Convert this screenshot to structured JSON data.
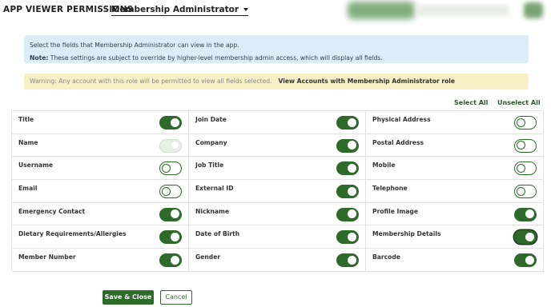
{
  "header": {
    "title": "APP VIEWER PERMISSIONS",
    "role_selected": "Membership Administrator"
  },
  "info": {
    "line1": "Select the fields that Membership Administrator can view in the app.",
    "note_label": "Note:",
    "note_text": " These settings are subject to override by higher-level membership admin access, which will display all fields."
  },
  "warning": {
    "text": "Warning: Any account with this role will be permitted to view all fields selected.",
    "link": "View Accounts with Membership Administrator role"
  },
  "bulk": {
    "select_all": "Select All",
    "unselect_all": "Unselect All"
  },
  "fields": [
    [
      {
        "label": "Title",
        "state": "on"
      },
      {
        "label": "Name",
        "state": "disabled"
      },
      {
        "label": "Username",
        "state": "off"
      },
      {
        "label": "Email",
        "state": "off"
      },
      {
        "label": "Emergency Contact",
        "state": "on"
      },
      {
        "label": "Dietary Requirements/Allergies",
        "state": "on"
      },
      {
        "label": "Member Number",
        "state": "on"
      }
    ],
    [
      {
        "label": "Join Date",
        "state": "on"
      },
      {
        "label": "Company",
        "state": "on"
      },
      {
        "label": "Job Title",
        "state": "on"
      },
      {
        "label": "External ID",
        "state": "on"
      },
      {
        "label": "Nickname",
        "state": "on"
      },
      {
        "label": "Date of Birth",
        "state": "on"
      },
      {
        "label": "Gender",
        "state": "on"
      }
    ],
    [
      {
        "label": "Physical Address",
        "state": "off"
      },
      {
        "label": "Postal Address",
        "state": "off"
      },
      {
        "label": "Mobile",
        "state": "off"
      },
      {
        "label": "Telephone",
        "state": "off"
      },
      {
        "label": "Profile Image",
        "state": "on"
      },
      {
        "label": "Membership Details",
        "state": "on-focused"
      },
      {
        "label": "Barcode",
        "state": "on"
      }
    ]
  ],
  "buttons": {
    "save": "Save & Close",
    "cancel": "Cancel"
  },
  "colors": {
    "accent": "#2e6b2a",
    "info_bg": "#dbeef8",
    "warning_bg": "#f7f0c6"
  }
}
